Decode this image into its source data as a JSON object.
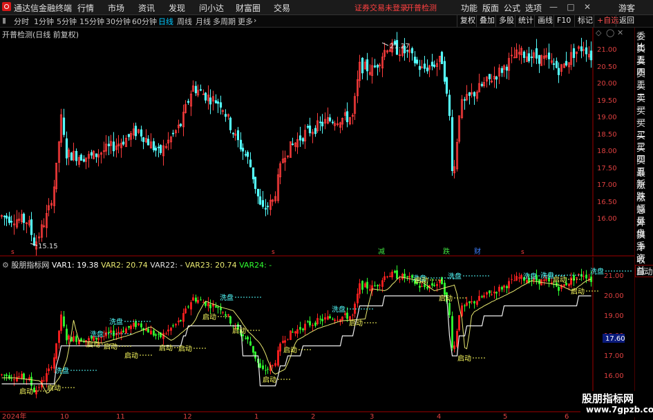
{
  "app": {
    "title": "通达信金融终端",
    "menu": [
      "行情",
      "市场",
      "资讯",
      "发现",
      "问小达",
      "财富圈",
      "交易"
    ],
    "alert": "证券交易未登录",
    "alert_link": "开普检测",
    "right_menu": [
      "功能",
      "版面",
      "公式",
      "选项"
    ],
    "user": "游客",
    "window_controls": {
      "minimize": "—",
      "restore": "□",
      "close": "✕"
    }
  },
  "periods": [
    "分时",
    "1分钟",
    "5分钟",
    "15分钟",
    "30分钟",
    "60分钟",
    "日线",
    "周线",
    "月线",
    "多周期",
    "更多"
  ],
  "active_period": "日线",
  "more_arrow": "›",
  "toolbar": [
    "复权",
    "叠加",
    "多股",
    "统计",
    "画线",
    "F10",
    "标记",
    "+自选",
    "返回"
  ],
  "sidebar": [
    "委比",
    "卖五",
    "卖四",
    "卖三",
    "卖二",
    "卖一",
    "买一",
    "买二",
    "买三",
    "买四",
    "买五",
    "最新",
    "涨跌",
    "涨幅",
    "总量",
    "外盘",
    "换手",
    "净资",
    "收益"
  ],
  "sidebar_auto": "自动",
  "main_panel": {
    "title": "开普检测(日线 前复权)",
    "price_axis": [
      "21.00",
      "20.50",
      "20.00",
      "19.50",
      "19.00",
      "18.50",
      "18.00",
      "17.50",
      "17.00",
      "16.50",
      "16.00"
    ],
    "high_label": "21.27",
    "low_label": "15.15",
    "markers": {
      "s": "s",
      "jian": "减",
      "die": "跌",
      "cai": "财"
    },
    "colors": {
      "up": "#ff3c3c",
      "down": "#54ffff",
      "axis": "#c80000"
    }
  },
  "indicator_panel": {
    "name": "股朋指标网",
    "var1_label": "VAR1: 19.38",
    "var2_label": "VAR2: 20.74",
    "var22_label": "VAR22: -",
    "var23_label": "VAR23: 20.74",
    "var24_label": "VAR24: -",
    "price_axis": [
      "21.00",
      "20.00",
      "19.00",
      "18.00",
      "17.00",
      "16.00"
    ],
    "current_price": "17.60",
    "tag_wash": "洗盘",
    "tag_start": "启动",
    "colors": {
      "up": "#ff2020",
      "down": "#30ff30",
      "line_yellow": "#e8e870",
      "line_white": "#f0f0f0"
    }
  },
  "date_axis": [
    "2024年",
    "10",
    "11",
    "12",
    "1",
    "2",
    "3",
    "4",
    "5",
    "6"
  ],
  "watermark": {
    "line1": "股朋指标网",
    "line2": "www.7gpzb.com"
  }
}
